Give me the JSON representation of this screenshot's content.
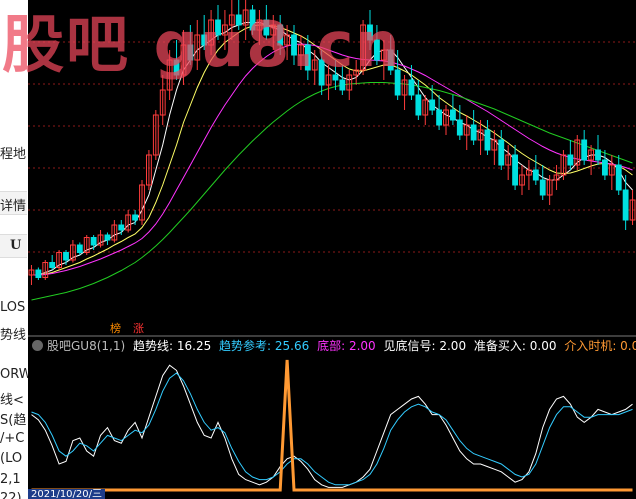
{
  "watermark": "股吧 gu8.cn",
  "left_panel": {
    "items": [
      "程地",
      "详情",
      "U",
      "LOS",
      "势线",
      "ORW",
      "线<",
      "S(趋",
      "/+C",
      "(LO",
      "2,1",
      "22)"
    ]
  },
  "badges": [
    {
      "label": "榜",
      "color": "#ff8c00"
    },
    {
      "label": "涨",
      "color": "#ff3333"
    }
  ],
  "indicator": {
    "name": "股吧GU8(1,1)",
    "fields": [
      {
        "label": "趋势线: 16.25",
        "color": "#ffffff"
      },
      {
        "label": "趋势参考: 25.66",
        "color": "#33ccff"
      },
      {
        "label": "底部: 2.00",
        "color": "#ff33ff"
      },
      {
        "label": "见底信号: 2.00",
        "color": "#ffffff"
      },
      {
        "label": "准备买入: 0.00",
        "color": "#ffffff"
      },
      {
        "label": "介入时机: 0.00",
        "color": "#ff9933"
      }
    ]
  },
  "date_label": "2021/10/20/三",
  "colors": {
    "up": "#ff3c3c",
    "down": "#00e0e0",
    "ma_white": "#ffffff",
    "ma_yellow": "#ffff66",
    "ma_magenta": "#ff33ff",
    "ma_green": "#22cc22",
    "grid": "#8b1a1a",
    "trend_line": "#ffffff",
    "trend_ref": "#33ccff",
    "signal": "#ff9933"
  },
  "chart_data": [
    {
      "type": "candlestick",
      "candles": [
        [
          5,
          7,
          3,
          6
        ],
        [
          6,
          6.5,
          4,
          4.5
        ],
        [
          4.5,
          8,
          4,
          7.5
        ],
        [
          7.5,
          9,
          6,
          6.5
        ],
        [
          6.5,
          10,
          6,
          9.5
        ],
        [
          9.5,
          10,
          7,
          8
        ],
        [
          8,
          12,
          7.5,
          11
        ],
        [
          11,
          11.5,
          9,
          9.5
        ],
        [
          9.5,
          13,
          9,
          12.5
        ],
        [
          12.5,
          13,
          10,
          11
        ],
        [
          11,
          14,
          10.5,
          13
        ],
        [
          13,
          13.5,
          11,
          12
        ],
        [
          12,
          16,
          11.5,
          15
        ],
        [
          15,
          16,
          13,
          14
        ],
        [
          14,
          18,
          13.5,
          17
        ],
        [
          17,
          18,
          15,
          16
        ],
        [
          16,
          24,
          15,
          23
        ],
        [
          23,
          30,
          22,
          29
        ],
        [
          29,
          38,
          28,
          37
        ],
        [
          37,
          45,
          35,
          42
        ],
        [
          42,
          50,
          40,
          48
        ],
        [
          48,
          52,
          44,
          45
        ],
        [
          45,
          54,
          43,
          51
        ],
        [
          51,
          55,
          47,
          48
        ],
        [
          48,
          56,
          46,
          53
        ],
        [
          53,
          57,
          50,
          51
        ],
        [
          51,
          58,
          49,
          56
        ],
        [
          56,
          59,
          52,
          53
        ],
        [
          53,
          58,
          50,
          55
        ],
        [
          55,
          60,
          52,
          57
        ],
        [
          57,
          61,
          54,
          55
        ],
        [
          55,
          60,
          52,
          58
        ],
        [
          58,
          59,
          53,
          54
        ],
        [
          54,
          58,
          51,
          56
        ],
        [
          56,
          59,
          52,
          53
        ],
        [
          53,
          57,
          50,
          55
        ],
        [
          55,
          57,
          49,
          51
        ],
        [
          51,
          55,
          48,
          53
        ],
        [
          53,
          55,
          47,
          49
        ],
        [
          49,
          53,
          46,
          51
        ],
        [
          51,
          53,
          44,
          46
        ],
        [
          46,
          50,
          43,
          48
        ],
        [
          48,
          50,
          41,
          43
        ],
        [
          43,
          47,
          40,
          45
        ],
        [
          45,
          48,
          42,
          44
        ],
        [
          44,
          47,
          41,
          42
        ],
        [
          42,
          46,
          40,
          45
        ],
        [
          45,
          48,
          43,
          46
        ],
        [
          46,
          56,
          45,
          55
        ],
        [
          55,
          58,
          50,
          52
        ],
        [
          52,
          55,
          47,
          48
        ],
        [
          48,
          52,
          44,
          50
        ],
        [
          50,
          53,
          45,
          46
        ],
        [
          46,
          50,
          40,
          41
        ],
        [
          41,
          45,
          38,
          44
        ],
        [
          44,
          47,
          40,
          41
        ],
        [
          41,
          44,
          36,
          37
        ],
        [
          37,
          41,
          35,
          40
        ],
        [
          40,
          43,
          37,
          38
        ],
        [
          38,
          41,
          34,
          35
        ],
        [
          35,
          39,
          33,
          38
        ],
        [
          38,
          41,
          35,
          36
        ],
        [
          36,
          39,
          32,
          33
        ],
        [
          33,
          37,
          30,
          35
        ],
        [
          35,
          38,
          31,
          32
        ],
        [
          32,
          36,
          29,
          34
        ],
        [
          34,
          36,
          29,
          30
        ],
        [
          30,
          34,
          27,
          32
        ],
        [
          32,
          34,
          26,
          27
        ],
        [
          27,
          31,
          24,
          29
        ],
        [
          29,
          31,
          22,
          23
        ],
        [
          23,
          27,
          21,
          25
        ],
        [
          25,
          28,
          22,
          26
        ],
        [
          26,
          29,
          23,
          24
        ],
        [
          24,
          27,
          20,
          21
        ],
        [
          21,
          25,
          19,
          24
        ],
        [
          24,
          27,
          22,
          25
        ],
        [
          25,
          30,
          24,
          29
        ],
        [
          29,
          32,
          26,
          27
        ],
        [
          27,
          33,
          26,
          32
        ],
        [
          32,
          34,
          27,
          28
        ],
        [
          28,
          31,
          25,
          30
        ],
        [
          30,
          33,
          27,
          28
        ],
        [
          28,
          30,
          24,
          25
        ],
        [
          25,
          29,
          22,
          27
        ],
        [
          27,
          29,
          21,
          22
        ],
        [
          22,
          25,
          14,
          16
        ],
        [
          16,
          22,
          15,
          20
        ]
      ],
      "moving_averages": [
        {
          "period": 5,
          "color": "#ffffff",
          "values": [
            5,
            5,
            5.5,
            6,
            7,
            7.5,
            8.5,
            9,
            10,
            10.5,
            11.5,
            12,
            13,
            13.5,
            15,
            15.5,
            18,
            21,
            26,
            31,
            37,
            42,
            46,
            48,
            50,
            51,
            52,
            53,
            53.5,
            54.5,
            55,
            55.5,
            55.5,
            55.5,
            55,
            54.5,
            54,
            53,
            52,
            51.5,
            50,
            49,
            47.5,
            46.5,
            45.5,
            44.5,
            44,
            44.5,
            46,
            48,
            49.5,
            50,
            50,
            48.5,
            46.5,
            44.5,
            42.5,
            40.5,
            39,
            38,
            37,
            36.5,
            35.5,
            35,
            34,
            33.5,
            32.5,
            32,
            30.5,
            29.5,
            28,
            27,
            26,
            25.5,
            24.5,
            24,
            24,
            25,
            26,
            27.5,
            28.5,
            29,
            29,
            28.5,
            27.5,
            26,
            23.5,
            22
          ]
        },
        {
          "period": 10,
          "color": "#ffff66",
          "values": [
            5,
            5,
            5.2,
            5.5,
            6,
            6.5,
            7,
            7.5,
            8.2,
            8.8,
            9.5,
            10.2,
            11,
            11.7,
            12.5,
            13.2,
            14.5,
            16.5,
            19.5,
            23,
            27,
            31,
            35.5,
            39,
            42.5,
            45.5,
            48,
            50,
            51.5,
            52.5,
            53.5,
            54.3,
            54.8,
            55,
            55,
            54.8,
            54.5,
            54,
            53.4,
            52.8,
            52,
            51,
            50,
            49,
            48,
            47,
            46.2,
            45.8,
            45.8,
            46.2,
            46.6,
            47,
            47,
            46.5,
            45.8,
            45,
            44,
            43,
            41.8,
            40.5,
            39.5,
            38.5,
            37.5,
            36.8,
            36,
            35.2,
            34.3,
            33.4,
            32.4,
            31.4,
            30.3,
            29.3,
            28.4,
            27.6,
            26.8,
            26,
            25.4,
            25.3,
            25.4,
            25.8,
            26.3,
            26.8,
            27.2,
            27.3,
            27.2,
            26.8,
            26,
            25
          ]
        },
        {
          "period": 20,
          "color": "#ff33ff",
          "values": [
            5,
            5,
            5.1,
            5.3,
            5.6,
            5.9,
            6.3,
            6.7,
            7.2,
            7.7,
            8.2,
            8.8,
            9.4,
            10,
            10.7,
            11.4,
            12.3,
            13.6,
            15.2,
            17.2,
            19.5,
            22,
            24.5,
            27,
            29.5,
            32,
            34.5,
            36.8,
            39,
            41,
            43,
            44.8,
            46.3,
            47.6,
            48.7,
            49.6,
            50.3,
            50.8,
            51.1,
            51.2,
            51.1,
            50.9,
            50.5,
            50,
            49.5,
            49,
            48.6,
            48.3,
            48.1,
            48,
            47.9,
            47.8,
            47.6,
            47.2,
            46.8,
            46.2,
            45.6,
            44.9,
            44.1,
            43.3,
            42.5,
            41.7,
            40.9,
            40.1,
            39.3,
            38.5,
            37.7,
            36.8,
            35.9,
            35,
            34.1,
            33.2,
            32.3,
            31.5,
            30.7,
            30,
            29.4,
            28.9,
            28.5,
            28.2,
            28,
            27.8,
            27.6,
            27.4,
            27.2,
            26.9,
            26.5,
            26
          ]
        },
        {
          "period": 60,
          "color": "#22cc22",
          "values": [
            0,
            0.3,
            0.6,
            0.9,
            1.2,
            1.5,
            1.9,
            2.3,
            2.8,
            3.3,
            3.9,
            4.5,
            5.2,
            5.9,
            6.7,
            7.5,
            8.5,
            9.6,
            10.8,
            12.1,
            13.5,
            15,
            16.5,
            18,
            19.6,
            21.2,
            22.8,
            24.4,
            26,
            27.5,
            29,
            30.4,
            31.8,
            33.1,
            34.4,
            35.6,
            36.7,
            37.8,
            38.8,
            39.7,
            40.5,
            41.2,
            41.8,
            42.3,
            42.7,
            43,
            43.2,
            43.3,
            43.4,
            43.5,
            43.5,
            43.5,
            43.4,
            43.3,
            43.2,
            43,
            42.8,
            42.5,
            42.2,
            41.9,
            41.5,
            41.1,
            40.7,
            40.2,
            39.7,
            39.2,
            38.7,
            38.2,
            37.6,
            37,
            36.4,
            35.8,
            35.2,
            34.6,
            34,
            33.4,
            32.9,
            32.4,
            31.9,
            31.4,
            30.9,
            30.4,
            29.9,
            29.4,
            28.9,
            28.4,
            27.9,
            27.4
          ]
        }
      ]
    },
    {
      "type": "line",
      "title": "股吧GU8(1,1)",
      "series": [
        {
          "name": "趋势线",
          "color": "#ffffff",
          "values": [
            58,
            54,
            46,
            34,
            20,
            22,
            38,
            40,
            30,
            26,
            42,
            48,
            38,
            36,
            46,
            52,
            40,
            56,
            72,
            88,
            96,
            92,
            80,
            66,
            52,
            42,
            40,
            52,
            40,
            24,
            12,
            8,
            6,
            4,
            6,
            10,
            18,
            24,
            26,
            22,
            16,
            8,
            4,
            2,
            2,
            2,
            4,
            6,
            10,
            16,
            30,
            44,
            58,
            62,
            66,
            70,
            72,
            66,
            58,
            58,
            50,
            40,
            30,
            24,
            20,
            20,
            18,
            16,
            14,
            10,
            6,
            8,
            14,
            28,
            48,
            62,
            70,
            72,
            66,
            56,
            52,
            56,
            62,
            60,
            58,
            60,
            62,
            66
          ]
        },
        {
          "name": "趋势参考",
          "color": "#33ccff",
          "values": [
            60,
            58,
            52,
            42,
            30,
            26,
            30,
            36,
            34,
            30,
            36,
            42,
            40,
            38,
            42,
            46,
            44,
            50,
            62,
            76,
            86,
            90,
            84,
            74,
            62,
            52,
            46,
            48,
            44,
            32,
            22,
            14,
            10,
            8,
            8,
            10,
            14,
            20,
            24,
            24,
            20,
            14,
            10,
            6,
            4,
            4,
            4,
            6,
            8,
            12,
            20,
            32,
            46,
            54,
            60,
            64,
            66,
            64,
            60,
            58,
            54,
            46,
            38,
            32,
            28,
            26,
            24,
            22,
            20,
            16,
            12,
            10,
            12,
            20,
            34,
            48,
            58,
            64,
            64,
            60,
            56,
            56,
            58,
            58,
            58,
            58,
            60,
            62
          ]
        },
        {
          "name": "介入时机",
          "color": "#ff9933",
          "values": [
            0,
            0,
            0,
            0,
            0,
            0,
            0,
            0,
            0,
            0,
            0,
            0,
            0,
            0,
            0,
            0,
            0,
            0,
            0,
            0,
            0,
            0,
            0,
            0,
            0,
            0,
            0,
            0,
            0,
            0,
            0,
            0,
            0,
            0,
            0,
            0,
            0,
            100,
            0,
            0,
            0,
            0,
            0,
            0,
            0,
            0,
            0,
            0,
            0,
            0,
            0,
            0,
            0,
            0,
            0,
            0,
            0,
            0,
            0,
            0,
            0,
            0,
            0,
            0,
            0,
            0,
            0,
            0,
            0,
            0,
            0,
            0,
            0,
            0,
            0,
            0,
            0,
            0,
            0,
            0,
            0,
            0,
            0,
            0,
            0,
            0,
            0,
            0
          ]
        }
      ]
    }
  ]
}
